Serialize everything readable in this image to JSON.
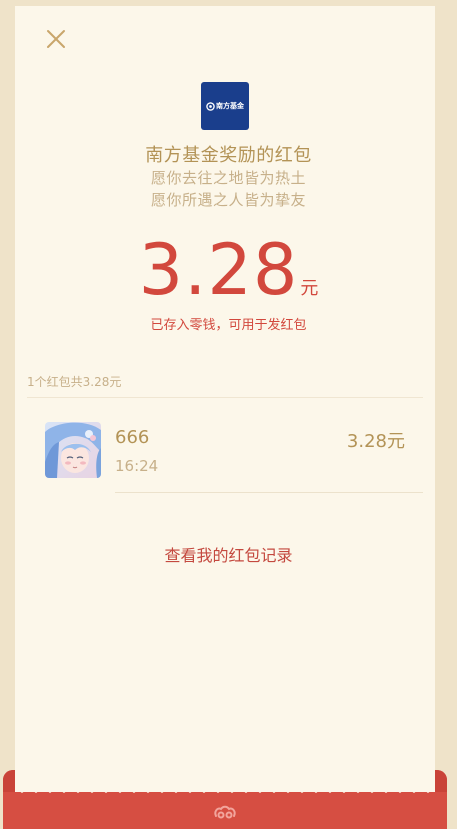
{
  "header": {
    "close_icon": "close-icon"
  },
  "sender": {
    "logo_text": "南方基金",
    "title": "南方基金奖励的红包",
    "wish_line1": "愿你去往之地皆为热土",
    "wish_line2": "愿你所遇之人皆为挚友"
  },
  "received": {
    "amount": "3.28",
    "unit": "元",
    "note": "已存入零钱，可用于发红包"
  },
  "summary": {
    "text": "1个红包共3.28元"
  },
  "records": [
    {
      "name": "666",
      "time": "16:24",
      "amount": "3.28元",
      "avatar_icon": "anime-avatar"
    }
  ],
  "footer": {
    "history_link": "查看我的红包记录",
    "envelope_icon": "red-packet-logo-icon"
  },
  "colors": {
    "background": "#efe3c9",
    "card": "#fcf7ea",
    "gold": "#b39356",
    "light_gold": "#c7b08a",
    "red": "#d2483d",
    "brand_blue": "#1a3e8c"
  }
}
